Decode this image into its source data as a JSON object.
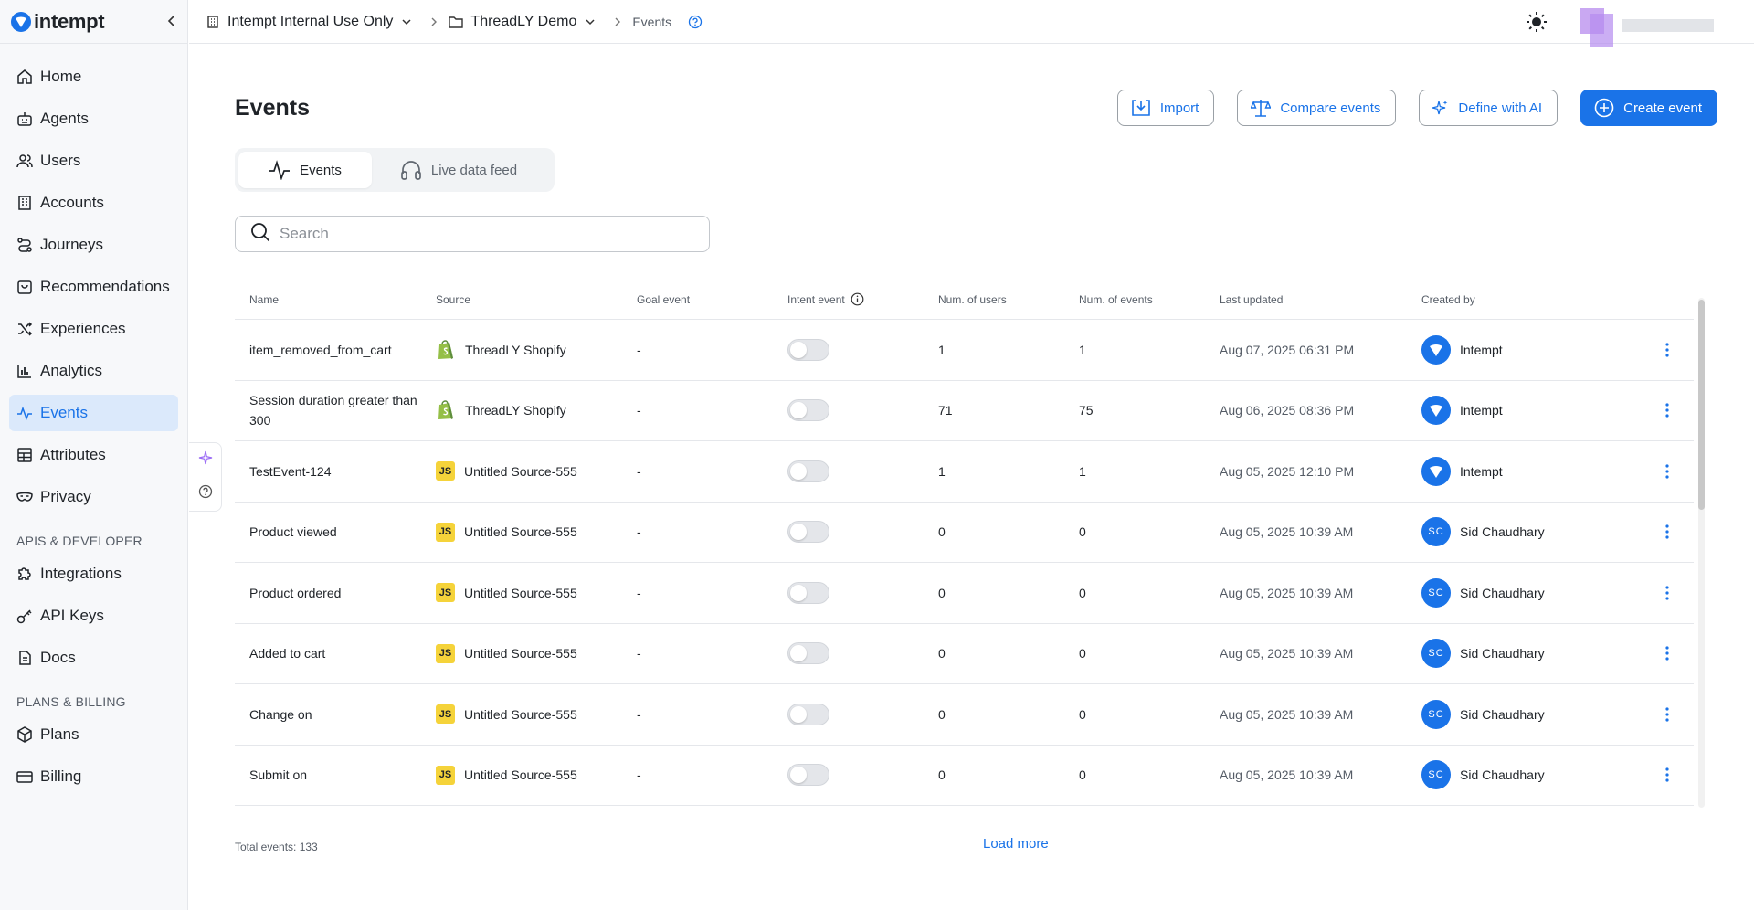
{
  "brand": {
    "name": "intempt",
    "color": "#1a73e8"
  },
  "sidebar": {
    "items": [
      {
        "label": "Home",
        "icon": "home-icon"
      },
      {
        "label": "Agents",
        "icon": "robot-icon"
      },
      {
        "label": "Users",
        "icon": "users-icon"
      },
      {
        "label": "Accounts",
        "icon": "building-icon"
      },
      {
        "label": "Journeys",
        "icon": "route-icon"
      },
      {
        "label": "Recommendations",
        "icon": "bag-icon"
      },
      {
        "label": "Experiences",
        "icon": "shuffle-icon"
      },
      {
        "label": "Analytics",
        "icon": "bar-chart-icon"
      },
      {
        "label": "Events",
        "icon": "pulse-icon",
        "active": true
      },
      {
        "label": "Attributes",
        "icon": "table-icon"
      },
      {
        "label": "Privacy",
        "icon": "mask-icon"
      }
    ],
    "section_api": "APIS & DEVELOPER",
    "api_items": [
      {
        "label": "Integrations",
        "icon": "puzzle-icon"
      },
      {
        "label": "API Keys",
        "icon": "key-icon"
      },
      {
        "label": "Docs",
        "icon": "document-icon"
      }
    ],
    "section_billing": "PLANS & BILLING",
    "billing_items": [
      {
        "label": "Plans",
        "icon": "box-icon"
      },
      {
        "label": "Billing",
        "icon": "card-icon"
      }
    ]
  },
  "topbar": {
    "org": "Intempt Internal Use Only",
    "project": "ThreadLY Demo",
    "page": "Events"
  },
  "page": {
    "title": "Events",
    "actions": {
      "import": "Import",
      "compare": "Compare events",
      "define_ai": "Define with AI",
      "create": "Create event"
    },
    "tabs": {
      "events": "Events",
      "live": "Live data feed"
    },
    "search_placeholder": "Search"
  },
  "table": {
    "headers": {
      "name": "Name",
      "source": "Source",
      "goal": "Goal event",
      "intent": "Intent event",
      "users": "Num. of users",
      "events": "Num. of events",
      "updated": "Last updated",
      "created_by": "Created by"
    },
    "rows": [
      {
        "name": "item_removed_from_cart",
        "source": "ThreadLY Shopify",
        "source_type": "shopify",
        "goal": "-",
        "intent_on": false,
        "users": "1",
        "events": "1",
        "updated": "Aug 07, 2025 06:31 PM",
        "creator": "Intempt",
        "creator_type": "logo"
      },
      {
        "name": "Session duration greater than 300",
        "source": "ThreadLY Shopify",
        "source_type": "shopify",
        "goal": "-",
        "intent_on": false,
        "users": "71",
        "events": "75",
        "updated": "Aug 06, 2025 08:36 PM",
        "creator": "Intempt",
        "creator_type": "logo"
      },
      {
        "name": "TestEvent-124",
        "source": "Untitled Source-555",
        "source_type": "js",
        "goal": "-",
        "intent_on": false,
        "users": "1",
        "events": "1",
        "updated": "Aug 05, 2025 12:10 PM",
        "creator": "Intempt",
        "creator_type": "logo"
      },
      {
        "name": "Product viewed",
        "source": "Untitled Source-555",
        "source_type": "js",
        "goal": "-",
        "intent_on": false,
        "users": "0",
        "events": "0",
        "updated": "Aug 05, 2025 10:39 AM",
        "creator": "Sid Chaudhary",
        "creator_type": "initials",
        "initials": "SC"
      },
      {
        "name": "Product ordered",
        "source": "Untitled Source-555",
        "source_type": "js",
        "goal": "-",
        "intent_on": false,
        "users": "0",
        "events": "0",
        "updated": "Aug 05, 2025 10:39 AM",
        "creator": "Sid Chaudhary",
        "creator_type": "initials",
        "initials": "SC"
      },
      {
        "name": "Added to cart",
        "source": "Untitled Source-555",
        "source_type": "js",
        "goal": "-",
        "intent_on": false,
        "users": "0",
        "events": "0",
        "updated": "Aug 05, 2025 10:39 AM",
        "creator": "Sid Chaudhary",
        "creator_type": "initials",
        "initials": "SC"
      },
      {
        "name": "Change on",
        "source": "Untitled Source-555",
        "source_type": "js",
        "goal": "-",
        "intent_on": false,
        "users": "0",
        "events": "0",
        "updated": "Aug 05, 2025 10:39 AM",
        "creator": "Sid Chaudhary",
        "creator_type": "initials",
        "initials": "SC"
      },
      {
        "name": "Submit on",
        "source": "Untitled Source-555",
        "source_type": "js",
        "goal": "-",
        "intent_on": false,
        "users": "0",
        "events": "0",
        "updated": "Aug 05, 2025 10:39 AM",
        "creator": "Sid Chaudhary",
        "creator_type": "initials",
        "initials": "SC"
      }
    ],
    "js_badge": "JS",
    "total": "Total events: 133",
    "load_more": "Load more"
  }
}
